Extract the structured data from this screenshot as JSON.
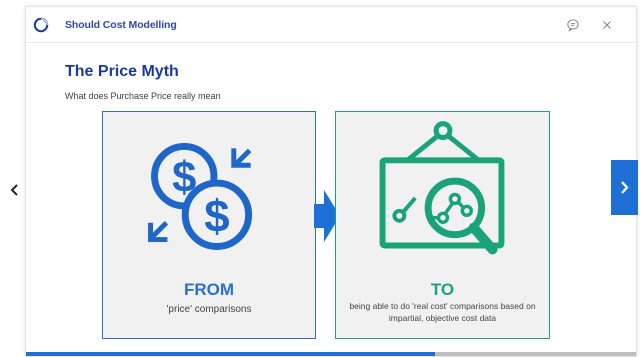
{
  "window": {
    "title": "Should Cost Modelling"
  },
  "slide": {
    "title": "The Price Myth",
    "subtitle": "What does Purchase Price really mean",
    "from_card": {
      "heading": "FROM",
      "description": "'price' comparisons",
      "icon": "currency-exchange-icon"
    },
    "to_card": {
      "heading": "TO",
      "description": "being able to do 'real cost' comparisons based on impartial, objective cost data",
      "icon": "chart-magnifier-icon"
    },
    "arrow_icon": "right-arrow-icon"
  },
  "navigation": {
    "prev_icon": "chevron-left-icon",
    "next_icon": "chevron-right-icon"
  },
  "progress": {
    "fraction": 0.67
  },
  "colors": {
    "brand_blue": "#1e6fd6",
    "title_blue": "#1a3a9c",
    "teal_green": "#1aa37a",
    "card_bg": "#f1f1f1"
  }
}
